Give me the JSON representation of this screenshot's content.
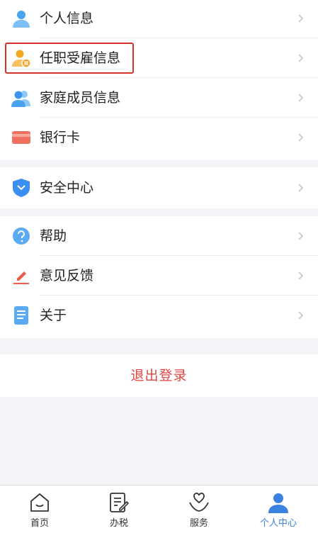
{
  "menu_group_1": [
    {
      "label": "个人信息",
      "icon": "person-icon"
    },
    {
      "label": "任职受雇信息",
      "icon": "employment-icon"
    },
    {
      "label": "家庭成员信息",
      "icon": "family-icon"
    },
    {
      "label": "银行卡",
      "icon": "bank-card-icon"
    }
  ],
  "menu_group_2": [
    {
      "label": "安全中心",
      "icon": "shield-icon"
    }
  ],
  "menu_group_3": [
    {
      "label": "帮助",
      "icon": "help-icon"
    },
    {
      "label": "意见反馈",
      "icon": "feedback-pen-icon"
    },
    {
      "label": "关于",
      "icon": "about-document-icon"
    }
  ],
  "logout_label": "退出登录",
  "tabs": [
    {
      "label": "首页",
      "icon": "home-icon"
    },
    {
      "label": "办税",
      "icon": "tax-edit-icon"
    },
    {
      "label": "服务",
      "icon": "service-heart-icon"
    },
    {
      "label": "个人中心",
      "icon": "profile-icon",
      "active": true
    }
  ],
  "colors": {
    "accent": "#3b82e0",
    "highlight_border": "#d8322c",
    "logout": "#e0463f"
  }
}
